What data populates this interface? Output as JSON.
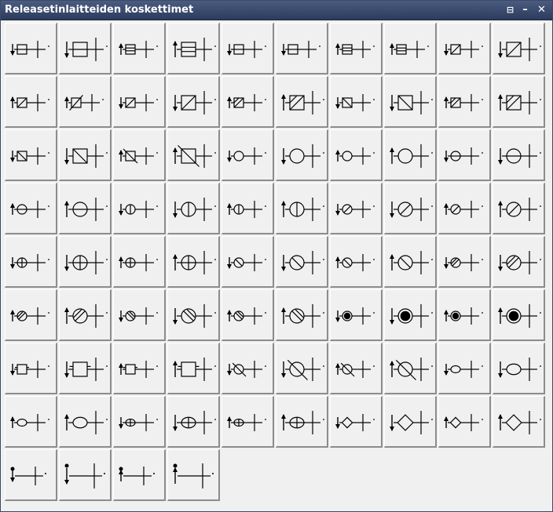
{
  "window": {
    "title": "Releasetinlaitteiden koskettimet",
    "pin_label": "⊟",
    "minimize_label": "–",
    "close_label": "✕"
  },
  "palette": {
    "icon_color": "#000000",
    "tile_bg": "#f0f0f0",
    "title_bg": "#34446a"
  },
  "symbols": [
    {
      "name": "contact-small-square-down",
      "arrow": "down",
      "shape": "square",
      "big": false
    },
    {
      "name": "contact-large-square-down",
      "arrow": "down",
      "shape": "square",
      "big": true
    },
    {
      "name": "contact-small-square-split-up",
      "arrow": "up",
      "shape": "square-split",
      "big": false
    },
    {
      "name": "contact-large-square-split-up",
      "arrow": "up",
      "shape": "square-split",
      "big": true
    },
    {
      "name": "contact-small-square-down-b",
      "arrow": "down",
      "shape": "square",
      "big": false
    },
    {
      "name": "contact-small-square-down-c",
      "arrow": "down",
      "shape": "square",
      "big": false
    },
    {
      "name": "contact-small-square-split-up-b",
      "arrow": "up",
      "shape": "square-split",
      "big": false
    },
    {
      "name": "contact-small-square-split-up-c",
      "arrow": "up",
      "shape": "square-split",
      "big": false
    },
    {
      "name": "contact-small-square-slash-down",
      "arrow": "down",
      "shape": "square-slash",
      "big": false
    },
    {
      "name": "contact-large-square-slash-down",
      "arrow": "down",
      "shape": "square-slash",
      "big": true
    },
    {
      "name": "contact-small-square-slash-up",
      "arrow": "up",
      "shape": "square-slash",
      "big": false
    },
    {
      "name": "contact-small-square-slash-up-long",
      "arrow": "up",
      "shape": "square-slash-long",
      "big": false
    },
    {
      "name": "contact-small-square-slash-down-b",
      "arrow": "down",
      "shape": "square-slash",
      "big": false
    },
    {
      "name": "contact-large-square-slash-down-b",
      "arrow": "down",
      "shape": "square-slash",
      "big": true
    },
    {
      "name": "contact-small-square-hatch-up",
      "arrow": "up",
      "shape": "square-hatch",
      "big": false
    },
    {
      "name": "contact-large-square-hatch-up",
      "arrow": "up",
      "shape": "square-hatch",
      "big": true
    },
    {
      "name": "contact-small-square-backslash-down",
      "arrow": "down",
      "shape": "square-backslash",
      "big": false
    },
    {
      "name": "contact-large-square-backslash-down",
      "arrow": "down",
      "shape": "square-backslash",
      "big": true
    },
    {
      "name": "contact-small-square-hatch-up-b",
      "arrow": "up",
      "shape": "square-hatch",
      "big": false
    },
    {
      "name": "contact-large-square-hatch-up-b",
      "arrow": "up",
      "shape": "square-hatch",
      "big": true
    },
    {
      "name": "contact-small-square-backslash-down-c",
      "arrow": "down",
      "shape": "square-backslash",
      "big": false
    },
    {
      "name": "contact-large-square-backslash-down-c",
      "arrow": "down",
      "shape": "square-backslash",
      "big": true
    },
    {
      "name": "contact-small-square-backslash-up-long",
      "arrow": "up",
      "shape": "square-backslash-long",
      "big": false
    },
    {
      "name": "contact-large-square-backslash-up-long",
      "arrow": "up",
      "shape": "square-backslash-long",
      "big": true
    },
    {
      "name": "contact-small-circle-down",
      "arrow": "down",
      "shape": "circle",
      "big": false
    },
    {
      "name": "contact-large-circle-down",
      "arrow": "down",
      "shape": "circle",
      "big": true
    },
    {
      "name": "contact-small-circle-up",
      "arrow": "up",
      "shape": "circle",
      "big": false
    },
    {
      "name": "contact-large-circle-up",
      "arrow": "up",
      "shape": "circle",
      "big": true
    },
    {
      "name": "contact-small-circle-h-down",
      "arrow": "down",
      "shape": "circle-h",
      "big": false
    },
    {
      "name": "contact-large-circle-h-down",
      "arrow": "down",
      "shape": "circle-h",
      "big": true
    },
    {
      "name": "contact-small-circle-h-up",
      "arrow": "up",
      "shape": "circle-h",
      "big": false
    },
    {
      "name": "contact-large-circle-h-up",
      "arrow": "up",
      "shape": "circle-h",
      "big": true
    },
    {
      "name": "contact-small-circle-v-down",
      "arrow": "down",
      "shape": "circle-v",
      "big": false
    },
    {
      "name": "contact-large-circle-v-down",
      "arrow": "down",
      "shape": "circle-v",
      "big": true
    },
    {
      "name": "contact-small-circle-v-up",
      "arrow": "up",
      "shape": "circle-v",
      "big": false
    },
    {
      "name": "contact-large-circle-v-up",
      "arrow": "up",
      "shape": "circle-v",
      "big": true
    },
    {
      "name": "contact-small-circle-slash-down",
      "arrow": "down",
      "shape": "circle-slash",
      "big": false
    },
    {
      "name": "contact-large-circle-slash-down",
      "arrow": "down",
      "shape": "circle-slash",
      "big": true
    },
    {
      "name": "contact-small-circle-slash-up",
      "arrow": "up",
      "shape": "circle-slash",
      "big": false
    },
    {
      "name": "contact-large-circle-slash-up",
      "arrow": "up",
      "shape": "circle-slash",
      "big": true
    },
    {
      "name": "contact-small-circle-cross-down",
      "arrow": "down",
      "shape": "circle-cross",
      "big": false
    },
    {
      "name": "contact-large-circle-cross-down",
      "arrow": "down",
      "shape": "circle-cross",
      "big": true
    },
    {
      "name": "contact-small-circle-cross-up",
      "arrow": "up",
      "shape": "circle-cross",
      "big": false
    },
    {
      "name": "contact-large-circle-cross-up",
      "arrow": "up",
      "shape": "circle-cross",
      "big": true
    },
    {
      "name": "contact-small-circle-backslash-down",
      "arrow": "down",
      "shape": "circle-backslash",
      "big": false
    },
    {
      "name": "contact-large-circle-backslash-down",
      "arrow": "down",
      "shape": "circle-backslash",
      "big": true
    },
    {
      "name": "contact-small-circle-backslash-up",
      "arrow": "up",
      "shape": "circle-backslash",
      "big": false
    },
    {
      "name": "contact-large-circle-backslash-up",
      "arrow": "up",
      "shape": "circle-backslash",
      "big": true
    },
    {
      "name": "contact-small-circle-hatch-down",
      "arrow": "down",
      "shape": "circle-hatch",
      "big": false
    },
    {
      "name": "contact-large-circle-hatch-down",
      "arrow": "down",
      "shape": "circle-hatch",
      "big": true
    },
    {
      "name": "contact-small-circle-hatch-up",
      "arrow": "up",
      "shape": "circle-hatch",
      "big": false
    },
    {
      "name": "contact-large-circle-hatch-up",
      "arrow": "up",
      "shape": "circle-hatch",
      "big": true
    },
    {
      "name": "contact-small-circle-bhatch-down",
      "arrow": "down",
      "shape": "circle-bhatch",
      "big": false
    },
    {
      "name": "contact-large-circle-bhatch-down",
      "arrow": "down",
      "shape": "circle-bhatch",
      "big": true
    },
    {
      "name": "contact-small-circle-bhatch-up",
      "arrow": "up",
      "shape": "circle-bhatch",
      "big": false
    },
    {
      "name": "contact-large-circle-bhatch-up",
      "arrow": "up",
      "shape": "circle-bhatch",
      "big": true
    },
    {
      "name": "contact-small-circle-filled-down",
      "arrow": "down",
      "shape": "circle-filled",
      "big": false
    },
    {
      "name": "contact-large-circle-filled-down",
      "arrow": "down",
      "shape": "circle-filled",
      "big": true
    },
    {
      "name": "contact-small-circle-filled-up",
      "arrow": "up",
      "shape": "circle-filled",
      "big": false
    },
    {
      "name": "contact-large-circle-filled-up",
      "arrow": "up",
      "shape": "circle-filled",
      "big": true
    },
    {
      "name": "contact-small-square-lamp-down",
      "arrow": "down",
      "shape": "square-lamp",
      "big": false
    },
    {
      "name": "contact-large-square-lamp-down",
      "arrow": "down",
      "shape": "square-lamp",
      "big": true
    },
    {
      "name": "contact-small-square-lamp-up",
      "arrow": "up",
      "shape": "square-lamp",
      "big": false
    },
    {
      "name": "contact-large-square-lamp-up",
      "arrow": "up",
      "shape": "square-lamp",
      "big": true
    },
    {
      "name": "contact-small-circle-longslash-down",
      "arrow": "down",
      "shape": "circle-longslash",
      "big": false
    },
    {
      "name": "contact-large-circle-longslash-down",
      "arrow": "down",
      "shape": "circle-longslash",
      "big": true
    },
    {
      "name": "contact-small-circle-longslash-up",
      "arrow": "up",
      "shape": "circle-longslash",
      "big": false
    },
    {
      "name": "contact-large-circle-longslash-up",
      "arrow": "up",
      "shape": "circle-longslash",
      "big": true
    },
    {
      "name": "contact-small-ellipse-line-down",
      "arrow": "down",
      "shape": "ellipse-line",
      "big": false
    },
    {
      "name": "contact-large-ellipse-line-down",
      "arrow": "down",
      "shape": "ellipse-line",
      "big": true
    },
    {
      "name": "contact-small-ellipse-line-up",
      "arrow": "up",
      "shape": "ellipse-line",
      "big": false
    },
    {
      "name": "contact-large-ellipse-line-up",
      "arrow": "up",
      "shape": "ellipse-line",
      "big": true
    },
    {
      "name": "contact-small-ellipse-cross-down",
      "arrow": "down",
      "shape": "ellipse-cross",
      "big": false
    },
    {
      "name": "contact-large-ellipse-cross-down",
      "arrow": "down",
      "shape": "ellipse-cross",
      "big": true
    },
    {
      "name": "contact-small-ellipse-cross-up",
      "arrow": "up",
      "shape": "ellipse-cross",
      "big": false
    },
    {
      "name": "contact-large-ellipse-cross-up",
      "arrow": "up",
      "shape": "ellipse-cross",
      "big": true
    },
    {
      "name": "contact-small-diamond-down",
      "arrow": "down",
      "shape": "diamond",
      "big": false
    },
    {
      "name": "contact-large-diamond-down",
      "arrow": "down",
      "shape": "diamond",
      "big": true
    },
    {
      "name": "contact-small-diamond-up",
      "arrow": "up",
      "shape": "diamond",
      "big": false
    },
    {
      "name": "contact-large-diamond-up",
      "arrow": "up",
      "shape": "diamond",
      "big": true
    },
    {
      "name": "contact-plain-down",
      "arrow": "down",
      "shape": "none",
      "big": false
    },
    {
      "name": "contact-plain-down-large",
      "arrow": "down",
      "shape": "none",
      "big": true
    },
    {
      "name": "contact-plain-up",
      "arrow": "up",
      "shape": "none",
      "big": false
    },
    {
      "name": "contact-plain-up-large",
      "arrow": "up",
      "shape": "none",
      "big": true
    }
  ]
}
